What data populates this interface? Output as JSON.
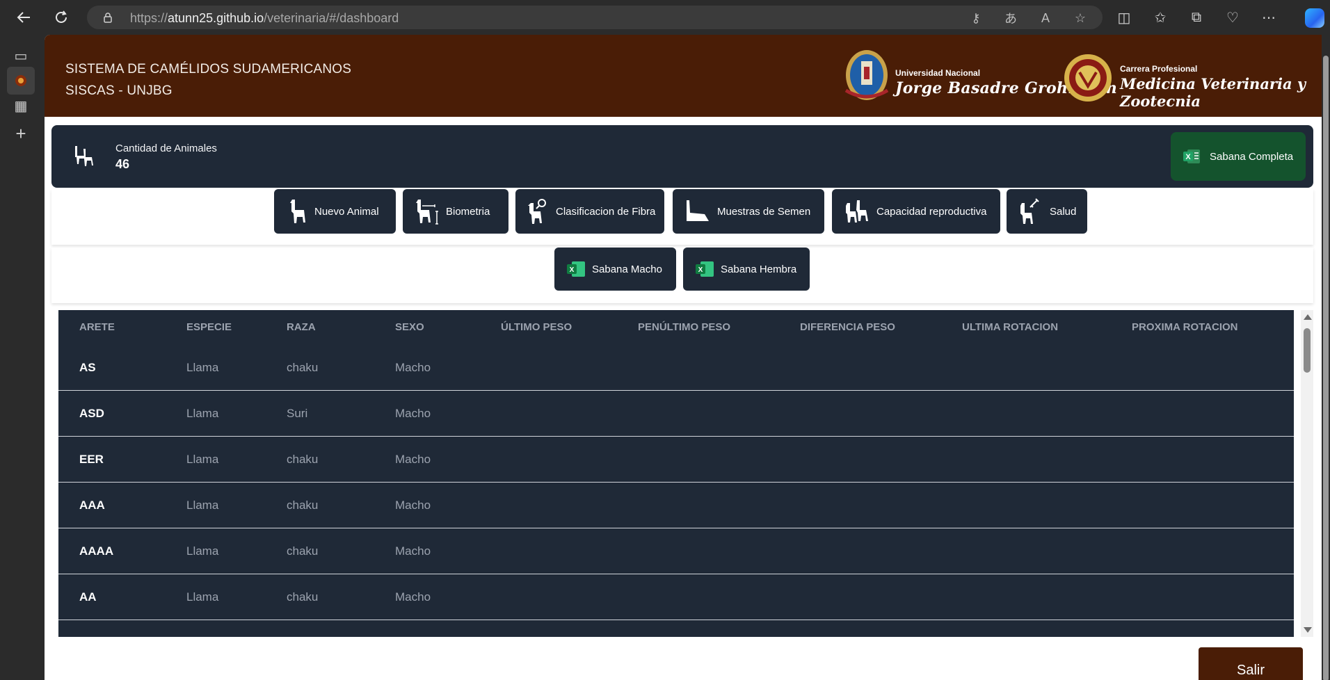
{
  "browser": {
    "url_prefix": "https://",
    "url_host": "atunn25.github.io",
    "url_path": "/veterinaria/#/dashboard"
  },
  "header": {
    "title_line1": "SISTEMA DE CAMÉLIDOS SUDAMERICANOS",
    "title_line2": "SISCAS - UNJBG",
    "uni_small": "Universidad Nacional",
    "uni_big": "Jorge Basadre Grohmann",
    "career_small": "Carrera Profesional",
    "career_big": "Medicina Veterinaria y Zootecnia"
  },
  "stats": {
    "label": "Cantidad de Animales",
    "value": "46",
    "sabana_completa": "Sabana Completa"
  },
  "actions": [
    {
      "label": "Nuevo Animal",
      "icon": "llama-icon"
    },
    {
      "label": "Biometria",
      "icon": "llama-measure-icon"
    },
    {
      "label": "Clasificacion de Fibra",
      "icon": "llama-magnifier-icon"
    },
    {
      "label": "Muestras de Semen",
      "icon": "llama-resting-icon"
    },
    {
      "label": "Capacidad reproductiva",
      "icon": "llama-pair-icon"
    },
    {
      "label": "Salud",
      "icon": "llama-syringe-icon"
    }
  ],
  "sabana": {
    "macho": "Sabana Macho",
    "hembra": "Sabana Hembra"
  },
  "table": {
    "headers": [
      "ARETE",
      "ESPECIE",
      "RAZA",
      "SEXO",
      "ÚLTIMO PESO",
      "PENÚLTIMO PESO",
      "DIFERENCIA PESO",
      "ULTIMA ROTACION",
      "PROXIMA ROTACION"
    ],
    "rows": [
      [
        "AS",
        "Llama",
        "chaku",
        "Macho"
      ],
      [
        "ASD",
        "Llama",
        "Suri",
        "Macho"
      ],
      [
        "EER",
        "Llama",
        "chaku",
        "Macho"
      ],
      [
        "AAA",
        "Llama",
        "chaku",
        "Macho"
      ],
      [
        "AAAA",
        "Llama",
        "chaku",
        "Macho"
      ],
      [
        "AA",
        "Llama",
        "chaku",
        "Macho"
      ]
    ]
  },
  "footer": {
    "salir": "Salir"
  },
  "colors": {
    "header": "#4a1d06",
    "panel": "#1f2937",
    "excel_green": "#14532d"
  }
}
